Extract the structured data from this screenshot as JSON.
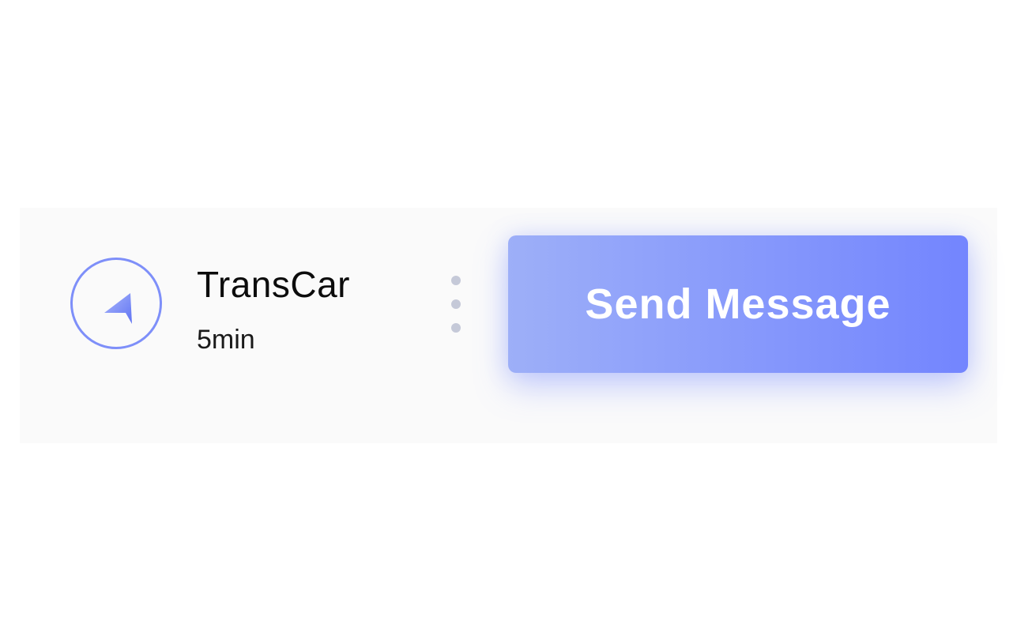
{
  "item": {
    "title": "TransCar",
    "eta": "5min",
    "icon": "navigation-arrow-icon",
    "menu_icon": "more-vertical-icon"
  },
  "actions": {
    "send_label": "Send Message"
  },
  "colors": {
    "accent": "#7e8ff9",
    "button_start": "#9daff8",
    "button_end": "#7385fe",
    "card_background": "#fafafa",
    "menu_dots": "#c5c9d8"
  }
}
